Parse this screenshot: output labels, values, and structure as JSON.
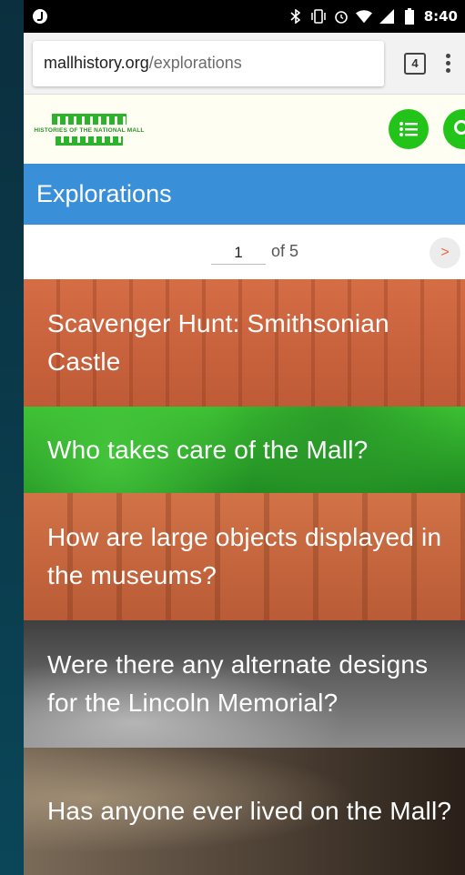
{
  "status_bar": {
    "time": "8:40",
    "icons": [
      "music-icon",
      "bluetooth-icon",
      "vibrate-icon",
      "alarm-icon",
      "wifi-icon",
      "signal-icon",
      "battery-icon"
    ]
  },
  "browser": {
    "url_domain": "mallhistory.org",
    "url_path": "/explorations",
    "tab_count": "4"
  },
  "site": {
    "logo_text": "HISTORIES OF THE NATIONAL MALL",
    "accent_color": "#22c41a"
  },
  "page": {
    "title": "Explorations",
    "title_band_color": "#3a8fd9"
  },
  "pager": {
    "current_page": "1",
    "of_label": "of 5",
    "next_label": ">"
  },
  "explorations": [
    {
      "title": "Scavenger Hunt: Smithsonian Castle"
    },
    {
      "title": "Who takes care of the Mall?"
    },
    {
      "title": "How are large objects displayed in the museums?"
    },
    {
      "title": "Were there any alternate designs for the Lincoln Memorial?"
    },
    {
      "title": "Has anyone ever lived on the Mall?"
    }
  ]
}
